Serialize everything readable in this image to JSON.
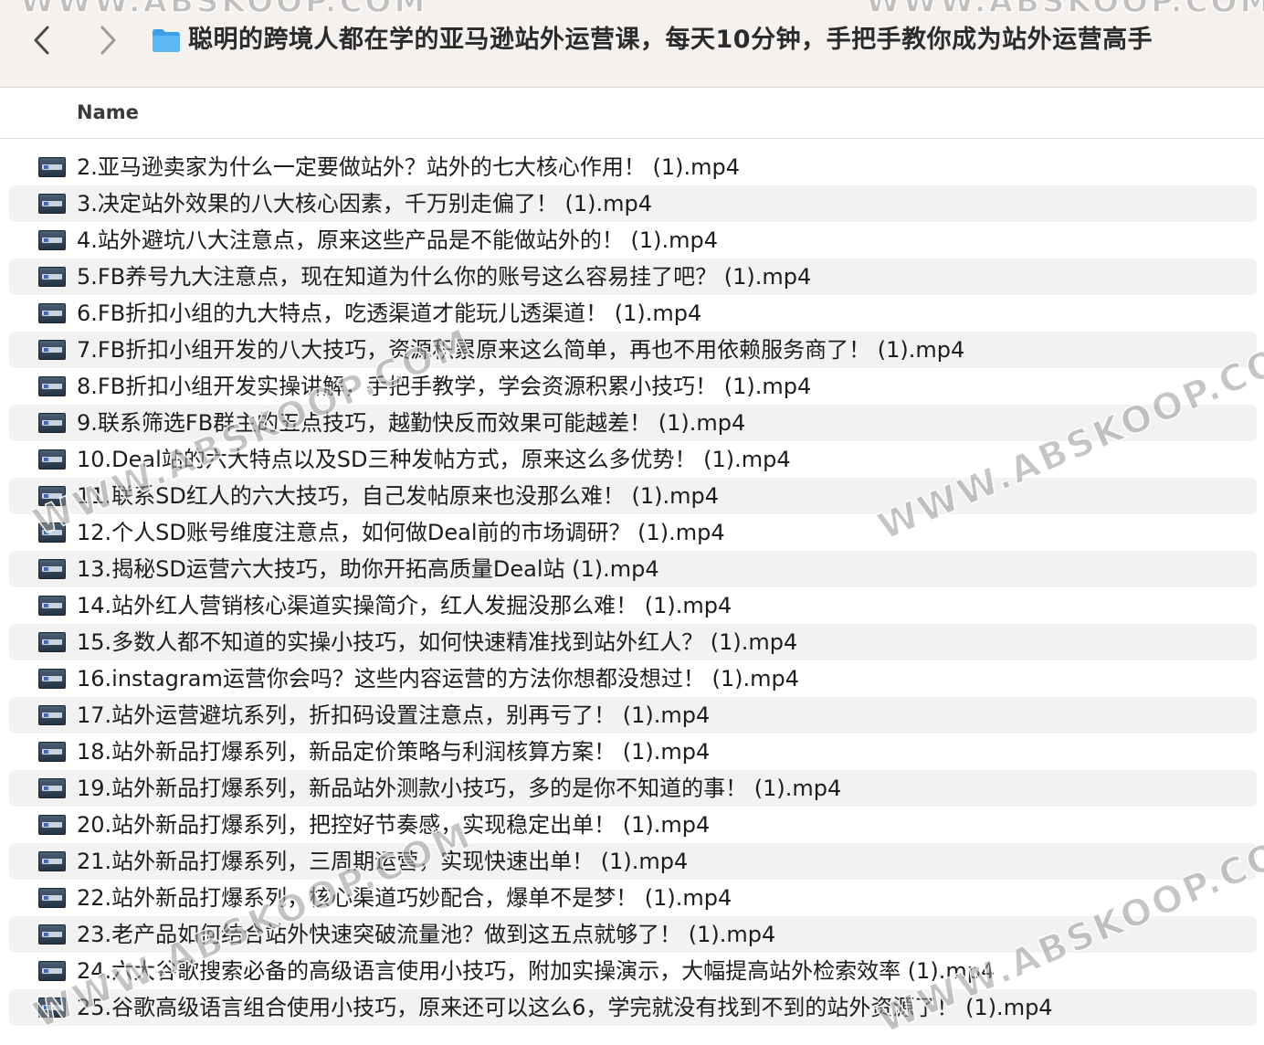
{
  "toolbar": {
    "back_icon": "chevron-left-icon",
    "forward_icon": "chevron-right-icon",
    "folder_icon": "folder-icon",
    "folder_color": "#3ca1e8",
    "title": "聪明的跨境人都在学的亚马逊站外运营课，每天10分钟，手把手教你成为站外运营高手"
  },
  "columns": {
    "name_label": "Name"
  },
  "files": [
    {
      "name": "2.亚马逊卖家为什么一定要做站外？站外的七大核心作用！ (1).mp4"
    },
    {
      "name": "3.决定站外效果的八大核心因素，千万别走偏了！ (1).mp4"
    },
    {
      "name": "4.站外避坑八大注意点，原来这些产品是不能做站外的！ (1).mp4"
    },
    {
      "name": "5.FB养号九大注意点，现在知道为什么你的账号这么容易挂了吧？ (1).mp4"
    },
    {
      "name": "6.FB折扣小组的九大特点，吃透渠道才能玩儿透渠道！ (1).mp4"
    },
    {
      "name": "7.FB折扣小组开发的八大技巧，资源积累原来这么简单，再也不用依赖服务商了！ (1).mp4"
    },
    {
      "name": "8.FB折扣小组开发实操讲解，手把手教学，学会资源积累小技巧！ (1).mp4"
    },
    {
      "name": "9.联系筛选FB群主的五点技巧，越勤快反而效果可能越差！ (1).mp4"
    },
    {
      "name": "10.Deal站的六大特点以及SD三种发帖方式，原来这么多优势！ (1).mp4"
    },
    {
      "name": "11.联系SD红人的六大技巧，自己发帖原来也没那么难！ (1).mp4"
    },
    {
      "name": "12.个人SD账号维度注意点，如何做Deal前的市场调研？ (1).mp4"
    },
    {
      "name": "13.揭秘SD运营六大技巧，助你开拓高质量Deal站 (1).mp4"
    },
    {
      "name": "14.站外红人营销核心渠道实操简介，红人发掘没那么难！ (1).mp4"
    },
    {
      "name": "15.多数人都不知道的实操小技巧，如何快速精准找到站外红人？ (1).mp4"
    },
    {
      "name": "16.instagram运营你会吗？这些内容运营的方法你想都没想过！ (1).mp4"
    },
    {
      "name": "17.站外运营避坑系列，折扣码设置注意点，别再亏了！ (1).mp4"
    },
    {
      "name": "18.站外新品打爆系列，新品定价策略与利润核算方案！ (1).mp4"
    },
    {
      "name": "19.站外新品打爆系列，新品站外测款小技巧，多的是你不知道的事！ (1).mp4"
    },
    {
      "name": "20.站外新品打爆系列，把控好节奏感，实现稳定出单！ (1).mp4"
    },
    {
      "name": "21.站外新品打爆系列，三周期运营，实现快速出单！ (1).mp4"
    },
    {
      "name": "22.站外新品打爆系列，核心渠道巧妙配合，爆单不是梦！ (1).mp4"
    },
    {
      "name": "23.老产品如何结合站外快速突破流量池？做到这五点就够了！ (1).mp4"
    },
    {
      "name": "24.六大谷歌搜索必备的高级语言使用小技巧，附加实操演示，大幅提高站外检索效率 (1).mp4"
    },
    {
      "name": "25.谷歌高级语言组合使用小技巧，原来还可以这么6，学完就没有找到不到的站外资源了！ (1).mp4"
    }
  ],
  "watermark": {
    "text": "WWW.ABSKOOP.COM"
  }
}
